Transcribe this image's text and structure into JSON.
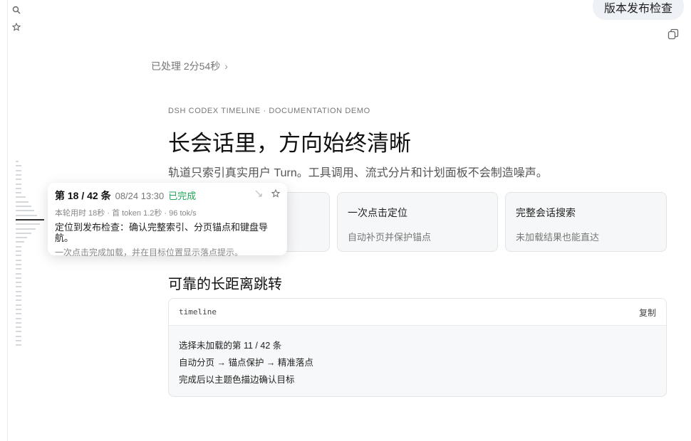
{
  "sidebar": {
    "icons": [
      "search-icon",
      "star-icon"
    ]
  },
  "user_message": {
    "text": "版本发布检查"
  },
  "processed": {
    "label": "已处理 2分54秒",
    "chevron": "›"
  },
  "article": {
    "kicker": "DSH CODEX TIMELINE · DOCUMENTATION DEMO",
    "headline": "长会话里，方向始终清晰",
    "subline": "轨道只索引真实用户 Turn。工具调用、流式分片和计划面板不会制造噪声。",
    "cards": [
      {
        "title": "一次点击定位",
        "desc": "自动补页并保护锚点"
      },
      {
        "title": "完整会话搜索",
        "desc": "未加载结果也能直达"
      }
    ],
    "section_title": "可靠的长距离跳转",
    "code": {
      "lang": "timeline",
      "copy_label": "复制",
      "lines": [
        "选择未加载的第 11 / 42 条",
        "自动分页 → 锚点保护 → 精准落点",
        "完成后以主题色描边确认目标"
      ]
    }
  },
  "timeline_popover": {
    "index": "第 18 / 42 条",
    "datetime": "08/24 13:30",
    "status": "已完成",
    "meta": "本轮用时 18秒 · 首 token 1.2秒 · 96 tok/s",
    "title": "定位到发布检查：确认完整索引、分页锚点和键盘导航。",
    "desc": "一次点击完成加载，并在目标位置显示落点提示。"
  },
  "colors": {
    "accent_status": "#22a559",
    "bubble": "#eef2f7",
    "card_bg": "#f6f7f8"
  }
}
